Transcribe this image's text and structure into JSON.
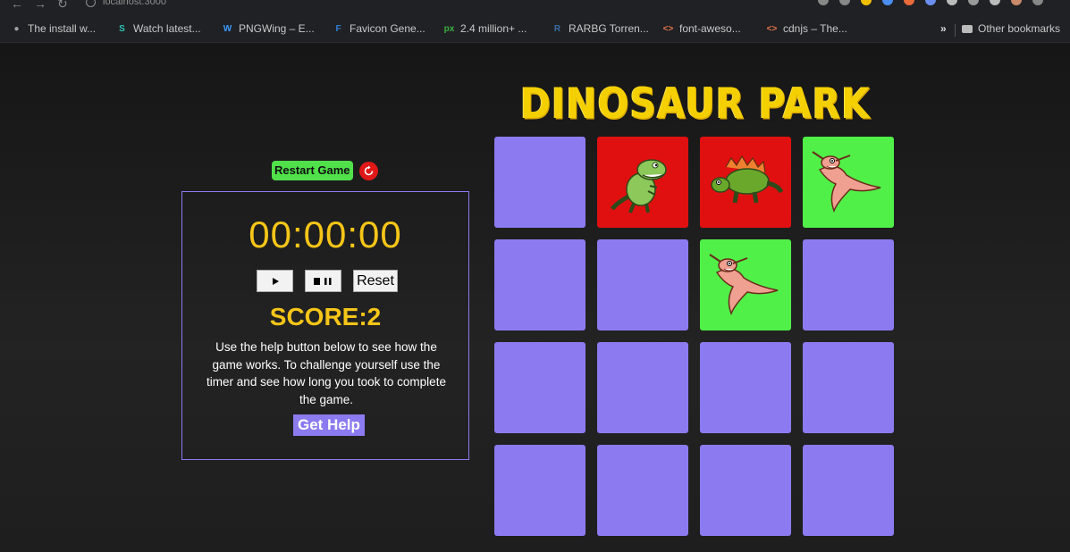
{
  "browser": {
    "url": "localhost:3000",
    "bookmarks": [
      {
        "label": "The install w...",
        "icon": "globe-icon",
        "color": "#9aa0a6"
      },
      {
        "label": "Watch latest...",
        "icon": "s-logo-icon",
        "color": "#2ec4b6"
      },
      {
        "label": "PNGWing – E...",
        "icon": "pngwing-logo-icon",
        "color": "#3b9cff"
      },
      {
        "label": "Favicon Gene...",
        "icon": "favicon-logo-icon",
        "color": "#2f7dd1"
      },
      {
        "label": "2.4 million+ ...",
        "icon": "px-logo-icon",
        "color": "#3cb043"
      },
      {
        "label": "RARBG Torren...",
        "icon": "r-logo-icon",
        "color": "#3a6ea5"
      },
      {
        "label": "font-aweso...",
        "icon": "code-icon",
        "color": "#e8734a"
      },
      {
        "label": "cdnjs – The...",
        "icon": "code-icon",
        "color": "#e8734a"
      }
    ],
    "more": "»",
    "other_bookmarks": "Other bookmarks"
  },
  "game": {
    "title": "DINOSAUR PARK",
    "restart_label": "Restart Game",
    "timer": "00:00:00",
    "reset_label": "Reset",
    "score": "SCORE:2",
    "help_text": "Use the help button below to see how the game works. To challenge yourself use the timer and see how long you took to complete the game.",
    "help_button": "Get Help"
  },
  "colors": {
    "accent_yellow": "#f5c518",
    "card_hidden": "#8c7bf0",
    "card_red": "#e01010",
    "card_green": "#50f048"
  },
  "cards": [
    {
      "state": "hidden"
    },
    {
      "state": "revealed",
      "color": "red",
      "image": "t-rex"
    },
    {
      "state": "revealed",
      "color": "red",
      "image": "stegosaurus"
    },
    {
      "state": "matched",
      "color": "green",
      "image": "pterodactyl"
    },
    {
      "state": "hidden"
    },
    {
      "state": "hidden"
    },
    {
      "state": "matched",
      "color": "green",
      "image": "pterodactyl"
    },
    {
      "state": "hidden"
    },
    {
      "state": "hidden"
    },
    {
      "state": "hidden"
    },
    {
      "state": "hidden"
    },
    {
      "state": "hidden"
    },
    {
      "state": "hidden"
    },
    {
      "state": "hidden"
    },
    {
      "state": "hidden"
    },
    {
      "state": "hidden"
    }
  ]
}
